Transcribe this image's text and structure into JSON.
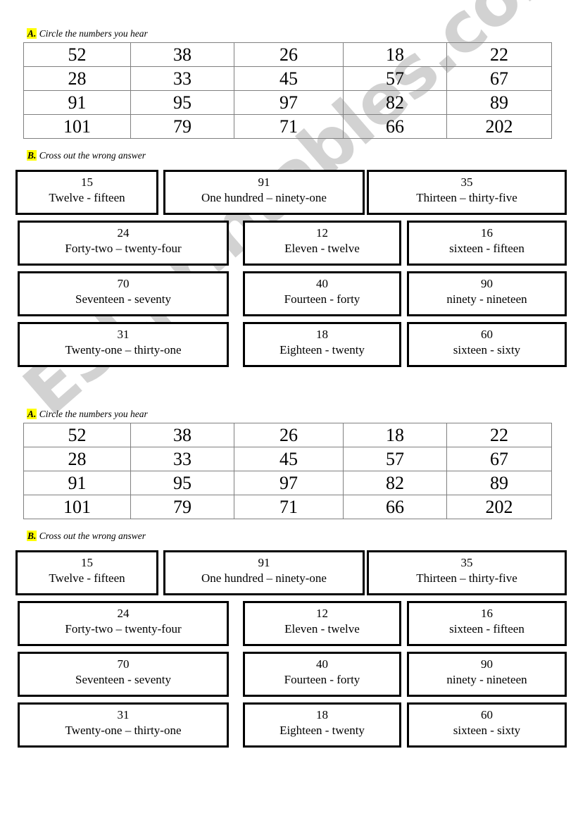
{
  "watermark": {
    "text": "ESLprintables.com",
    "color": "#d2d2d2"
  },
  "highlight_color": "#ffff00",
  "sections": {
    "a": {
      "letter": "A.",
      "label": "Circle the numbers you hear",
      "table": {
        "rows": [
          [
            "52",
            "38",
            "26",
            "18",
            "22"
          ],
          [
            "28",
            "33",
            "45",
            "57",
            "67"
          ],
          [
            "91",
            "95",
            "97",
            "82",
            "89"
          ],
          [
            "101",
            "79",
            "71",
            "66",
            "202"
          ]
        ]
      }
    },
    "b": {
      "letter": "B.",
      "label": "Cross out the wrong answer",
      "boxes": [
        [
          {
            "number": "15",
            "words": "Twelve - fifteen"
          },
          {
            "number": "91",
            "words": "One hundred – ninety-one"
          },
          {
            "number": "35",
            "words": "Thirteen – thirty-five"
          }
        ],
        [
          {
            "number": "24",
            "words": "Forty-two – twenty-four"
          },
          {
            "number": "12",
            "words": "Eleven - twelve"
          },
          {
            "number": "16",
            "words": "sixteen - fifteen"
          }
        ],
        [
          {
            "number": "70",
            "words": "Seventeen - seventy"
          },
          {
            "number": "40",
            "words": "Fourteen - forty"
          },
          {
            "number": "90",
            "words": "ninety - nineteen"
          }
        ],
        [
          {
            "number": "31",
            "words": "Twenty-one – thirty-one"
          },
          {
            "number": "18",
            "words": "Eighteen - twenty"
          },
          {
            "number": "60",
            "words": "sixteen - sixty"
          }
        ]
      ]
    }
  }
}
